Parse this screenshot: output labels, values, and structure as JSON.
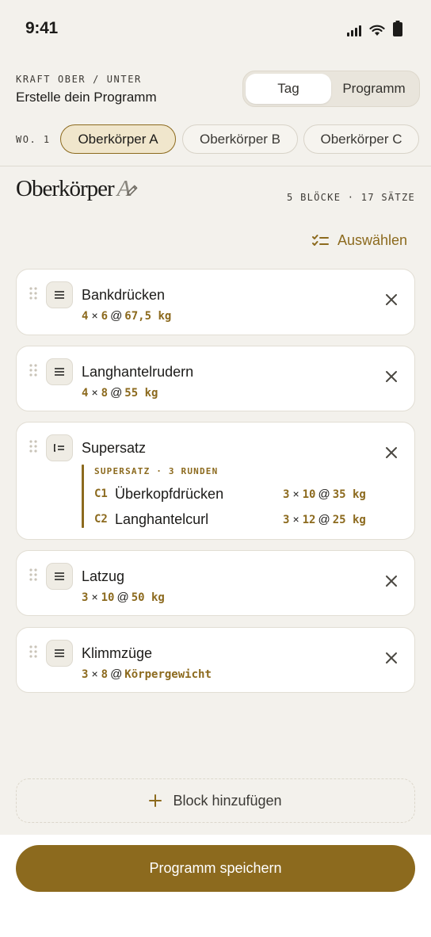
{
  "status_bar": {
    "time": "9:41"
  },
  "header": {
    "eyebrow": "KRAFT OBER / UNTER",
    "subtitle": "Erstelle dein Programm",
    "segments": [
      "Tag",
      "Programm"
    ],
    "active_segment": "Tag"
  },
  "week_label": "WO. 1",
  "days": [
    "Oberkörper A",
    "Oberkörper B",
    "Oberkörper C"
  ],
  "active_day": "Oberkörper A",
  "title": {
    "main": "Oberkörper",
    "suffix": "A"
  },
  "meta": "5 BLÖCKE · 17 SÄTZE",
  "select_label": "Auswählen",
  "blocks": [
    {
      "name": "Bankdrücken",
      "sets": "4",
      "reps": "6",
      "weight": "67,5 kg"
    },
    {
      "name": "Langhantelrudern",
      "sets": "4",
      "reps": "8",
      "weight": "55 kg"
    },
    {
      "name": "Supersatz",
      "header": "SUPERSATZ · 3 RUNDEN",
      "items": [
        {
          "code": "C1",
          "name": "Überkopfdrücken",
          "sets": "3",
          "reps": "10",
          "weight": "35 kg"
        },
        {
          "code": "C2",
          "name": "Langhantelcurl",
          "sets": "3",
          "reps": "12",
          "weight": "25 kg"
        }
      ]
    },
    {
      "name": "Latzug",
      "sets": "3",
      "reps": "10",
      "weight": "50 kg"
    },
    {
      "name": "Klimmzüge",
      "sets": "3",
      "reps": "8",
      "weight": "Körpergewicht"
    }
  ],
  "add_block_label": "Block hinzufügen",
  "save_label": "Programm speichern",
  "colors": {
    "accent": "#8c6a1e",
    "background": "#f3f1ec",
    "card": "#ffffff",
    "chip_active": "#f0e6cc"
  }
}
